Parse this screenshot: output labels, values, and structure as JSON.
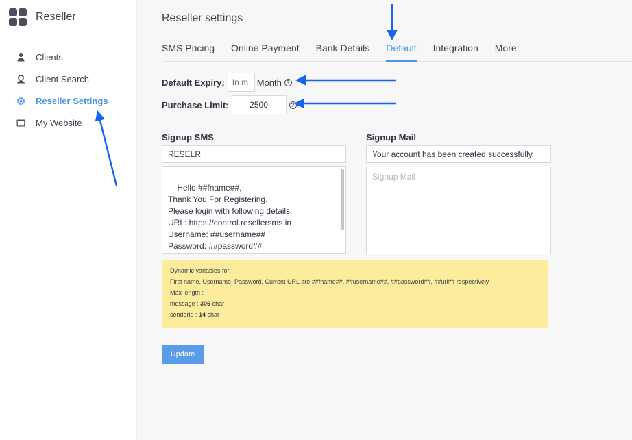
{
  "brand": {
    "title": "Reseller"
  },
  "sidebar": {
    "items": [
      {
        "label": "Clients",
        "icon": "users-icon",
        "active": false
      },
      {
        "label": "Client Search",
        "icon": "user-search-icon",
        "active": false
      },
      {
        "label": "Reseller Settings",
        "icon": "gear-icon",
        "active": true
      },
      {
        "label": "My Website",
        "icon": "browser-window-icon",
        "active": false
      }
    ]
  },
  "page": {
    "title": "Reseller settings"
  },
  "tabs": [
    {
      "label": "SMS Pricing",
      "active": false
    },
    {
      "label": "Online Payment",
      "active": false
    },
    {
      "label": "Bank Details",
      "active": false
    },
    {
      "label": "Default",
      "active": true
    },
    {
      "label": "Integration",
      "active": false
    },
    {
      "label": "More",
      "active": false
    }
  ],
  "form": {
    "expiry_label": "Default Expiry:",
    "expiry_placeholder": "In m",
    "expiry_value": "",
    "expiry_unit": "Month",
    "limit_label": "Purchase Limit:",
    "limit_value": "2500"
  },
  "signup_sms": {
    "title": "Signup SMS",
    "sender": "RESELR",
    "message": "Hello ##fname##,\nThank You For Registering.\nPlease login with following details.\nURL: https://control.resellersms.in\nUsername: ##username##\nPassword: ##password##"
  },
  "signup_mail": {
    "title": "Signup Mail",
    "subject": "Your account has been created successfully.",
    "body_placeholder": "Signup Mail"
  },
  "notice": {
    "line1": "Dynamic variables for:",
    "line2": "First name, Username, Password, Current URL are ##fname##, ##username##, ##password##, ##url## respectively",
    "line3": "Max length :",
    "message_label": "message : ",
    "message_value": "306",
    "message_unit": " char",
    "senderid_label": "senderid : ",
    "senderid_value": "14",
    "senderid_unit": " char"
  },
  "actions": {
    "update_label": "Update"
  },
  "colors": {
    "accent": "#4b93e6",
    "arrow": "#1565f0",
    "notice_bg": "#fcec9c",
    "button": "#5b9ce8"
  }
}
